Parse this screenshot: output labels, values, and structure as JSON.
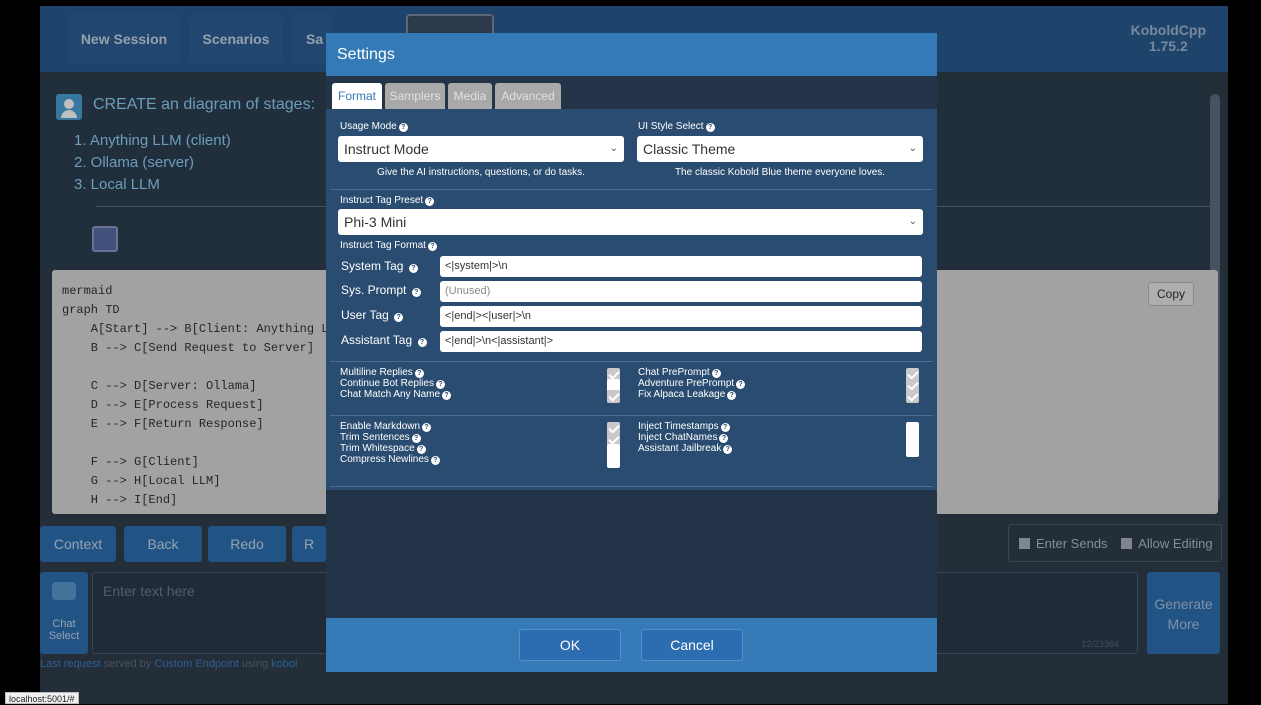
{
  "nav": {
    "new_session": "New Session",
    "scenarios": "Scenarios",
    "save_partial": "Sa",
    "brand": "KoboldCpp",
    "version": "1.75.2"
  },
  "chat": {
    "prompt": "CREATE an diagram  of stages:",
    "steps": [
      "1. Anything LLM (client)",
      "2. Ollama (server)",
      "3.  Local LLM"
    ],
    "code_lines": [
      "mermaid",
      "graph TD",
      "    A[Start] --> B[Client: Anything L",
      "    B --> C[Send Request to Server]",
      "",
      "    C --> D[Server: Ollama]",
      "    D --> E[Process Request]",
      "    E --> F[Return Response]",
      "",
      "    F --> G[Client]",
      "    G --> H[Local LLM]",
      "    H --> I[End]"
    ],
    "copy_label": "Copy"
  },
  "bottom_bar": {
    "context": "Context",
    "back": "Back",
    "redo": "Redo",
    "retry_partial": "R",
    "enter_sends": "Enter Sends",
    "allow_editing": "Allow Editing"
  },
  "input": {
    "chat_select": [
      "Chat",
      "Select"
    ],
    "placeholder": "Enter text here",
    "token_count": "12/23364",
    "generate": [
      "Generate",
      "More"
    ],
    "footer_parts": [
      "Last request",
      " served by ",
      "Custom Endpoint",
      " using ",
      "kobol"
    ]
  },
  "status_url": "localhost:5001/#",
  "settings": {
    "title": "Settings",
    "tabs": [
      "Format",
      "Samplers",
      "Media",
      "Advanced"
    ],
    "usage_mode_label": "Usage Mode",
    "usage_mode_value": "Instruct Mode",
    "usage_mode_hint": "Give the AI instructions, questions, or do tasks.",
    "ui_style_label": "UI Style Select",
    "ui_style_value": "Classic Theme",
    "ui_style_hint": "The classic Kobold Blue theme everyone loves.",
    "preset_label": "Instruct Tag Preset",
    "preset_value": "Phi-3 Mini",
    "format_label": "Instruct Tag Format",
    "rows": [
      {
        "label": "System Tag",
        "value": "<|system|>\\n",
        "placeholder": false
      },
      {
        "label": "Sys. Prompt",
        "value": "(Unused)",
        "placeholder": true
      },
      {
        "label": "User Tag",
        "value": "<|end|><|user|>\\n",
        "placeholder": false
      },
      {
        "label": "Assistant Tag",
        "value": "<|end|>\\n<|assistant|>",
        "placeholder": false
      }
    ],
    "flags_group1_left": [
      {
        "label": "Multiline Replies",
        "checked": true
      },
      {
        "label": "Continue Bot Replies",
        "checked": false
      },
      {
        "label": "Chat Match Any Name",
        "checked": true
      }
    ],
    "flags_group1_right": [
      {
        "label": "Chat PrePrompt",
        "checked": true
      },
      {
        "label": "Adventure PrePrompt",
        "checked": true
      },
      {
        "label": "Fix Alpaca Leakage",
        "checked": true
      }
    ],
    "flags_group2_left": [
      {
        "label": "Enable Markdown",
        "checked": true
      },
      {
        "label": "Trim Sentences",
        "checked": true
      },
      {
        "label": "Trim Whitespace",
        "checked": false
      },
      {
        "label": "Compress Newlines",
        "checked": false
      }
    ],
    "flags_group2_right": [
      {
        "label": "Inject Timestamps",
        "checked": false
      },
      {
        "label": "Inject ChatNames",
        "checked": false
      },
      {
        "label": "Assistant Jailbreak",
        "checked": false
      }
    ],
    "ok": "OK",
    "cancel": "Cancel"
  }
}
